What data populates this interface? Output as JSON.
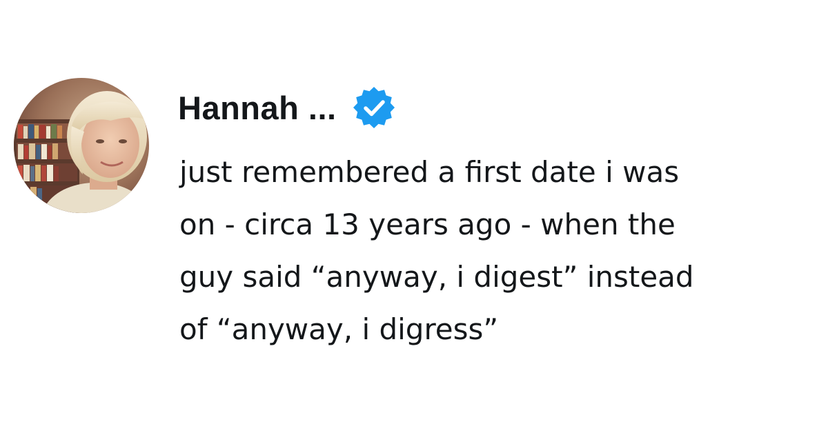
{
  "author": {
    "display_name": "Hannah ...",
    "verified": true,
    "avatar_icon": "profile-photo",
    "verified_icon": "verified-badge-icon"
  },
  "tweet": {
    "text_lines": [
      "just remembered a first date i was",
      "on - circa 13 years ago - when the",
      "guy said “anyway, i digest” instead",
      "of “anyway, i digress”"
    ]
  },
  "colors": {
    "text": "#14171a",
    "verified_badge": "#1d9bf0",
    "background": "#ffffff"
  }
}
